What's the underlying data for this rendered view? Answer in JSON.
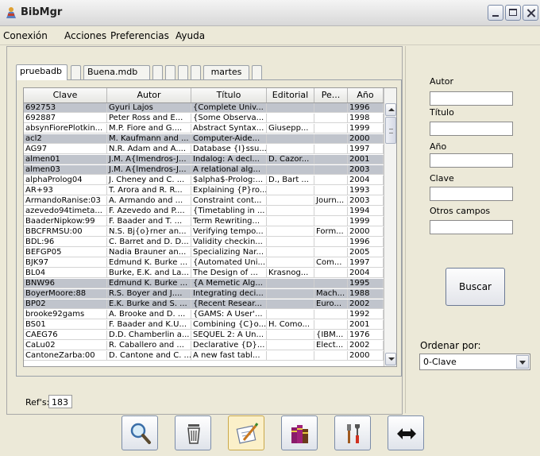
{
  "window": {
    "title": "BibMgr"
  },
  "menu": [
    "Conexión",
    "Acciones",
    "Preferencias",
    "Ayuda"
  ],
  "tabs": [
    {
      "label": "pruebadb",
      "active": true
    },
    {
      "label": ""
    },
    {
      "label": "Buena.mdb"
    },
    {
      "label": ""
    },
    {
      "label": ""
    },
    {
      "label": ""
    },
    {
      "label": ""
    },
    {
      "label": "martes"
    },
    {
      "label": ""
    }
  ],
  "table": {
    "columns": [
      "Clave",
      "Autor",
      "Título",
      "Editorial",
      "Pe...",
      "Año"
    ],
    "rows": [
      {
        "sel": true,
        "cells": [
          "692753",
          "Gyuri Lajos",
          "{Complete Univ...",
          "",
          "",
          "1996"
        ]
      },
      {
        "sel": false,
        "cells": [
          "692887",
          "Peter Ross and E...",
          "{Some Observa...",
          "",
          "",
          "1998"
        ]
      },
      {
        "sel": false,
        "cells": [
          "absynFiorePlotkin...",
          "M.P. Fiore and G....",
          "Abstract Syntax...",
          "Giusepp...",
          "",
          "1999"
        ]
      },
      {
        "sel": true,
        "cells": [
          "acl2",
          "M. Kaufmann and ...",
          "Computer-Aide...",
          "",
          "",
          "2000"
        ]
      },
      {
        "sel": false,
        "cells": [
          "AG97",
          "N.R. Adam and A....",
          "Database {I}ssu...",
          "",
          "",
          "1997"
        ]
      },
      {
        "sel": true,
        "cells": [
          "almen01",
          "J.M. A{lmendros-J...",
          "Indalog: A decl...",
          "D. Cazor...",
          "",
          "2001"
        ]
      },
      {
        "sel": true,
        "cells": [
          "almen03",
          "J.M. A{lmendros-J...",
          "A relational alg...",
          "",
          "",
          "2003"
        ]
      },
      {
        "sel": false,
        "cells": [
          "alphaProlog04",
          "J. Cheney and C. ...",
          "$alpha$-Prolog:...",
          "D., Bart ...",
          "",
          "2004"
        ]
      },
      {
        "sel": false,
        "cells": [
          "AR+93",
          "T. Arora and R. R...",
          "Explaining {P}ro...",
          "",
          "",
          "1993"
        ]
      },
      {
        "sel": false,
        "cells": [
          "ArmandoRanise:03",
          "A. Armando and ...",
          "Constraint cont...",
          "",
          "Journ...",
          "2003"
        ]
      },
      {
        "sel": false,
        "cells": [
          "azevedo94timeta...",
          "F. Azevedo and P....",
          "{Timetabling in ...",
          "",
          "",
          "1994"
        ]
      },
      {
        "sel": false,
        "cells": [
          "BaaderNipkow:99",
          "F. Baader and T. ...",
          "Term Rewriting...",
          "",
          "",
          "1999"
        ]
      },
      {
        "sel": false,
        "cells": [
          "BBCFRMSU:00",
          "N.S. Bj{o}rner an...",
          "Verifying tempo...",
          "",
          "Form...",
          "2000"
        ]
      },
      {
        "sel": false,
        "cells": [
          "BDL:96",
          "C. Barret and D. D...",
          "Validity checkin...",
          "",
          "",
          "1996"
        ]
      },
      {
        "sel": false,
        "cells": [
          "BEFGP05",
          "Nadia Brauner an...",
          "Specializing Nar...",
          "",
          "",
          "2005"
        ]
      },
      {
        "sel": false,
        "cells": [
          "BJK97",
          "Edmund K. Burke ...",
          "{Automated Uni...",
          "",
          "Com...",
          "1997"
        ]
      },
      {
        "sel": false,
        "cells": [
          "BL04",
          "Burke, E.K. and La...",
          "The Design of ...",
          "Krasnog...",
          "",
          "2004"
        ]
      },
      {
        "sel": true,
        "cells": [
          "BNW96",
          "Edmund K. Burke ...",
          "{A Memetic Alg...",
          "",
          "",
          "1995"
        ]
      },
      {
        "sel": true,
        "cells": [
          "BoyerMoore:88",
          "R.S. Boyer and J....",
          "Integrating deci...",
          "",
          "Mach...",
          "1988"
        ]
      },
      {
        "sel": true,
        "cells": [
          "BP02",
          "E.K. Burke and S. ...",
          "{Recent Resear...",
          "",
          "Euro...",
          "2002"
        ]
      },
      {
        "sel": false,
        "cells": [
          "brooke92gams",
          "A. Brooke and D. ...",
          "{GAMS: A User'...",
          "",
          "",
          "1992"
        ]
      },
      {
        "sel": false,
        "cells": [
          "BS01",
          "F. Baader and K.U...",
          "Combining {C}o...",
          "H. Como...",
          "",
          "2001"
        ]
      },
      {
        "sel": false,
        "cells": [
          "CAEG76",
          "D.D. Chamberlin a...",
          "SEQUEL 2: A Un...",
          "",
          "{IBM...",
          "1976"
        ]
      },
      {
        "sel": false,
        "cells": [
          "CaLu02",
          "R. Caballero and ...",
          "Declarative {D}...",
          "",
          "Elect...",
          "2002"
        ]
      },
      {
        "sel": false,
        "cells": [
          "CantoneZarba:00",
          "D. Cantone and C. ...",
          "A new fast tabl...",
          "",
          "",
          "2000"
        ]
      }
    ]
  },
  "refs": {
    "label": "Ref's:",
    "value": "183"
  },
  "search": {
    "fields": [
      "Autor",
      "Título",
      "Año",
      "Clave",
      "Otros campos"
    ],
    "button": "Buscar",
    "order_label": "Ordenar por:",
    "order_value": "0-Clave"
  },
  "toolbar": [
    "search-icon",
    "trash-icon",
    "edit-icon",
    "books-icon",
    "tools-icon",
    "swap-arrows-icon"
  ]
}
